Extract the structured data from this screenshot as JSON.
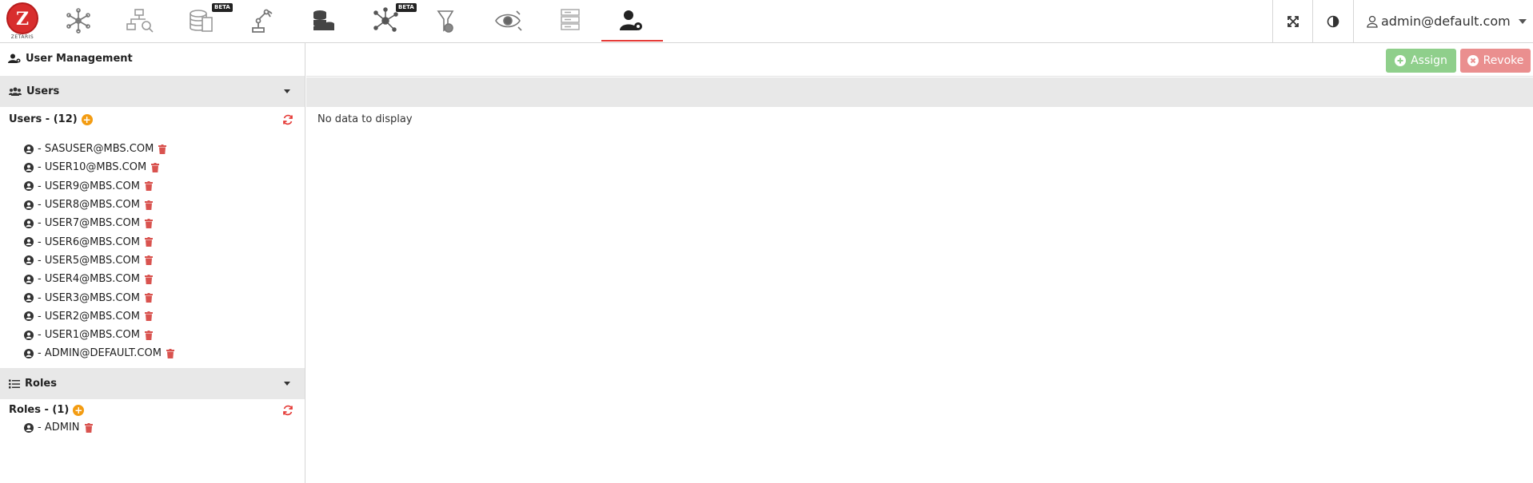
{
  "app": {
    "logo_text": "Z",
    "logo_word": "ZETARIS",
    "nav_icons": [
      "network-icon",
      "hierarchy-search-icon",
      "database-doc-icon",
      "robot-arm-icon",
      "database-stack-icon",
      "graph-network-icon",
      "settings-flask-icon",
      "eye-ai-icon",
      "server-rack-icon",
      "user-management-icon"
    ],
    "beta_label": "BETA",
    "user_email": "admin@default.com"
  },
  "sidebar": {
    "title": "User Management",
    "users_section": "Users",
    "users_group_title": "Users - (12)",
    "users": [
      "- SASUSER@MBS.COM",
      "- USER10@MBS.COM",
      "- USER9@MBS.COM",
      "- USER8@MBS.COM",
      "- USER7@MBS.COM",
      "- USER6@MBS.COM",
      "- USER5@MBS.COM",
      "- USER4@MBS.COM",
      "- USER3@MBS.COM",
      "- USER2@MBS.COM",
      "- USER1@MBS.COM",
      "- ADMIN@DEFAULT.COM"
    ],
    "roles_section": "Roles",
    "roles_group_title": "Roles - (1)",
    "roles": [
      "- ADMIN"
    ]
  },
  "main": {
    "assign_label": "Assign",
    "revoke_label": "Revoke",
    "empty_message": "No data to display"
  },
  "colors": {
    "accent_red": "#e53935",
    "trash_red": "#d9534f",
    "add_orange": "#f39c12",
    "assign_green": "#8fcf8b",
    "revoke_red": "#ea8f8f"
  }
}
